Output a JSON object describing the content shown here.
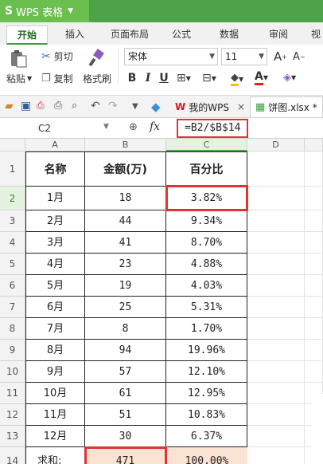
{
  "app": {
    "logo": "S",
    "title": "WPS 表格"
  },
  "tabs": [
    "开始",
    "插入",
    "页面布局",
    "公式",
    "数据",
    "审阅",
    "视"
  ],
  "ribbon": {
    "paste": "粘贴",
    "cut": "剪切",
    "copy": "复制",
    "format_painter": "格式刷",
    "font_name": "宋体",
    "font_size": "11",
    "bold": "B",
    "italic": "I",
    "underline": "U",
    "font_color_letter": "A",
    "grow_font": "A",
    "shrink_font": "A"
  },
  "doc_tabs": [
    {
      "label": "我的WPS",
      "close": "×"
    },
    {
      "label": "饼图.xlsx *"
    }
  ],
  "formula_bar": {
    "cell_ref": "C2",
    "fx": "fx",
    "formula": "=B2/$B$14"
  },
  "columns": [
    "A",
    "B",
    "C",
    "D"
  ],
  "rows": [
    "1",
    "2",
    "3",
    "4",
    "5",
    "6",
    "7",
    "8",
    "9",
    "10",
    "11",
    "12",
    "13",
    "14"
  ],
  "table": {
    "headers": [
      "名称",
      "金额(万)",
      "百分比"
    ],
    "data": [
      [
        "1月",
        "18",
        "3.82%"
      ],
      [
        "2月",
        "44",
        "9.34%"
      ],
      [
        "3月",
        "41",
        "8.70%"
      ],
      [
        "4月",
        "23",
        "4.88%"
      ],
      [
        "5月",
        "19",
        "4.03%"
      ],
      [
        "6月",
        "25",
        "5.31%"
      ],
      [
        "7月",
        "8",
        "1.70%"
      ],
      [
        "8月",
        "94",
        "19.96%"
      ],
      [
        "9月",
        "57",
        "12.10%"
      ],
      [
        "10月",
        "61",
        "12.95%"
      ],
      [
        "11月",
        "51",
        "10.83%"
      ],
      [
        "12月",
        "30",
        "6.37%"
      ]
    ],
    "total": [
      "求和:",
      "471",
      "100.00%"
    ]
  },
  "colors": {
    "titlebar": "#4ea34a",
    "highlight": "#e03333",
    "total_fill": "#fbe3d4",
    "active_cell_border": "#4ea34a"
  }
}
